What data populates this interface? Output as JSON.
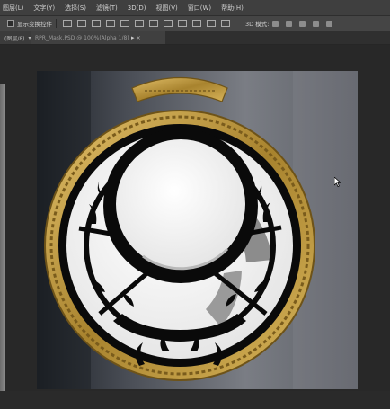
{
  "menubar": {
    "items": [
      "图层(L)",
      "文字(Y)",
      "选择(S)",
      "滤镜(T)",
      "3D(D)",
      "视图(V)",
      "窗口(W)",
      "帮助(H)"
    ]
  },
  "options_bar": {
    "show_transform_label": "显示变换控件",
    "mode_3d_label": "3D 模式:"
  },
  "tabs": [
    {
      "label": "(图层/8)",
      "arrow": "▾"
    },
    {
      "label": "RPR_Mask.PSD @ 100%(Alpha 1/8)",
      "close": "×"
    }
  ],
  "tab_overflow_arrow": "▸",
  "colors": {
    "ui_background": "#3a3a3a",
    "gold": "#c9a44c",
    "black_ring": "#0a0a0a",
    "white_mask": "#f2f2f2",
    "gray_mask": "#8c8c8c"
  },
  "icons": [
    "checkbox-icon",
    "move-tool-icon",
    "3d-rotate-icon",
    "3d-roll-icon",
    "3d-pan-icon",
    "3d-slide-icon",
    "3d-scale-icon",
    "cursor-icon"
  ]
}
